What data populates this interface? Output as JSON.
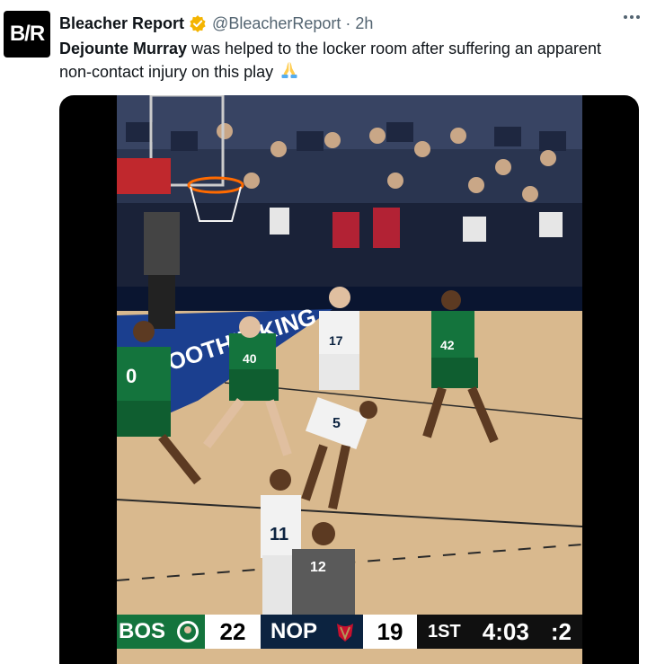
{
  "account": {
    "avatar_text": "B/R",
    "display_name": "Bleacher Report",
    "handle": "@BleacherReport",
    "separator": "·",
    "time": "2h"
  },
  "tweet": {
    "bold_name": "Dejounte Murray",
    "body": " was helped to the locker room after suffering an apparent non-contact injury on this play",
    "emoji": "praying-hands-icon"
  },
  "scoreboard": {
    "team1_abbr": "BOS",
    "team1_score": "22",
    "team2_abbr": "NOP",
    "team2_score": "19",
    "quarter": "1ST",
    "game_clock": "4:03",
    "shot_clock": ":2"
  },
  "colors": {
    "verified": "#f4b400",
    "celtics": "#14743d",
    "pelicans": "#0c2340",
    "court": "#d9b98e",
    "lane_blue": "#1b3f8f"
  },
  "court_text": {
    "sponsor": "SMOOTHIE KING",
    "jersey_tatum": "0",
    "jersey_kornet": "40",
    "jersey_horford": "42",
    "jersey_pels_17": "17",
    "jersey_murray": "5",
    "jersey_pels_11": "11",
    "jersey_ref": "12"
  }
}
